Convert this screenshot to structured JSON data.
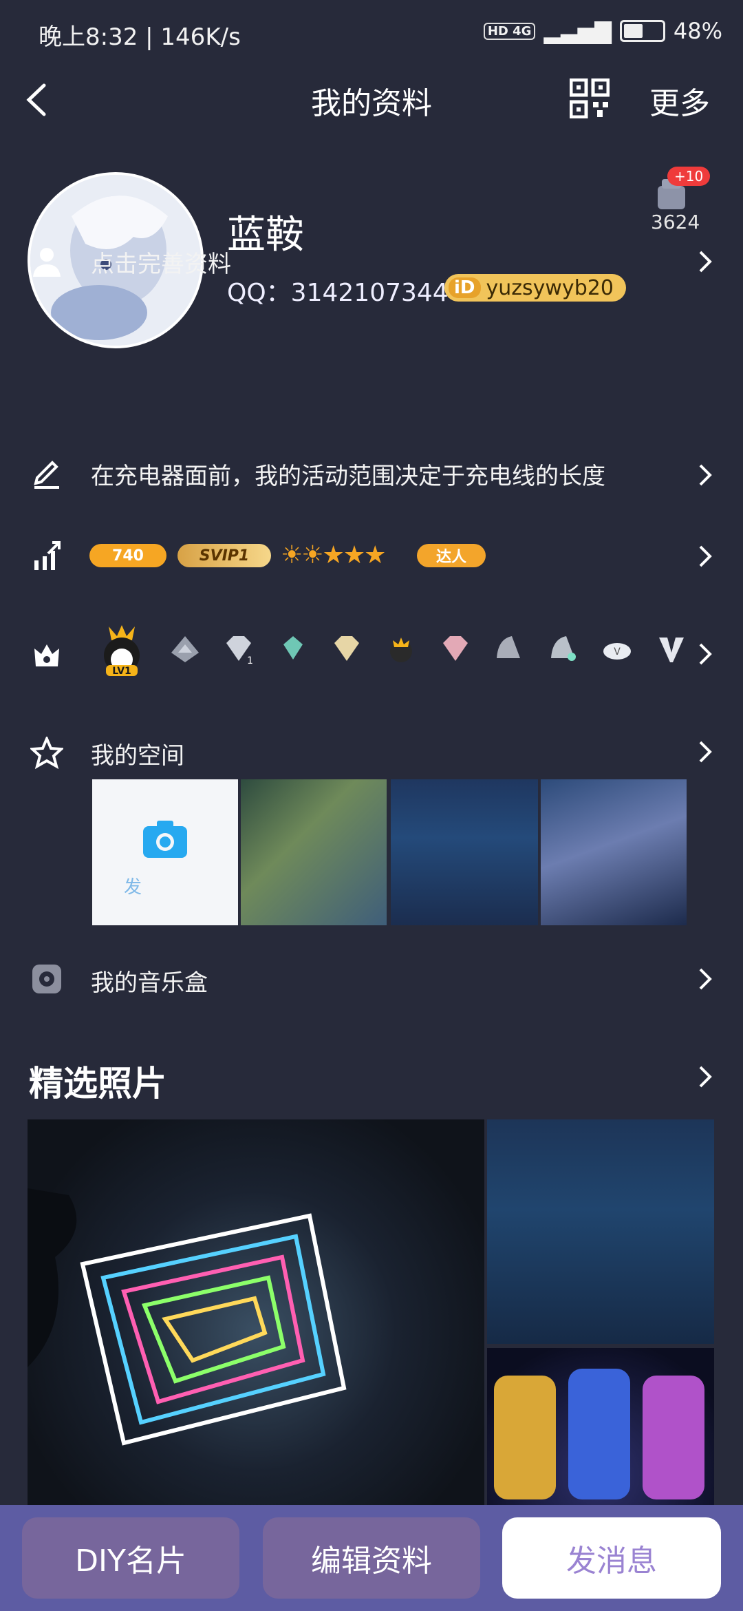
{
  "status_bar": {
    "left": "晚上8:32 | 146K/s",
    "network": "HD 4G",
    "battery": "48%"
  },
  "nav": {
    "title": "我的资料",
    "more": "更多"
  },
  "profile": {
    "nickname": "蓝鞍",
    "qq": "QQ：3142107344",
    "id_tag": "iD",
    "id_value": "yuzsywyb20",
    "likes_plus": "+10",
    "likes_count": "3624"
  },
  "rows": {
    "complete_profile": "点击完善资料",
    "signature": "在充电器面前，我的活动范围决定于充电线的长度",
    "level_value": "740",
    "svip": "SVIP1",
    "talent": "达人",
    "badge_lv": "LV1",
    "space": "我的空间",
    "space_post": "发",
    "music": "我的音乐盒"
  },
  "photos_section": {
    "title": "精选照片"
  },
  "buttons": {
    "diy": "DIY名片",
    "edit": "编辑资料",
    "message": "发消息"
  }
}
